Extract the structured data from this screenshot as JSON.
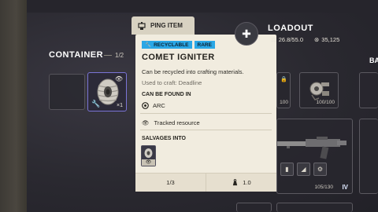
{
  "container": {
    "title": "CONTAINER",
    "count": "1/2",
    "item_quantity": "×1"
  },
  "ping": {
    "label": "PING ITEM"
  },
  "tooltip": {
    "tags": [
      "RECYCLABLE",
      "RARE"
    ],
    "name": "COMET IGNITER",
    "description": "Can be recycled into crafting materials.",
    "used_to_craft": "Used to craft: Deadline",
    "found_in_heading": "CAN BE FOUND IN",
    "found_in": "ARC",
    "tracked": "Tracked resource",
    "salvages_heading": "SALVAGES INTO",
    "footer_count": "1/3",
    "footer_weight": "1.0",
    "tag_color": "#2aa7e6"
  },
  "loadout": {
    "title": "LOADOUT",
    "weight": "26.8/55.0",
    "coins": "35,125",
    "slot_durability": "100",
    "slot_durability_b": "100/100",
    "gun_durability": "105/130",
    "gun_tier": "IV",
    "next_section_label": "BA"
  }
}
